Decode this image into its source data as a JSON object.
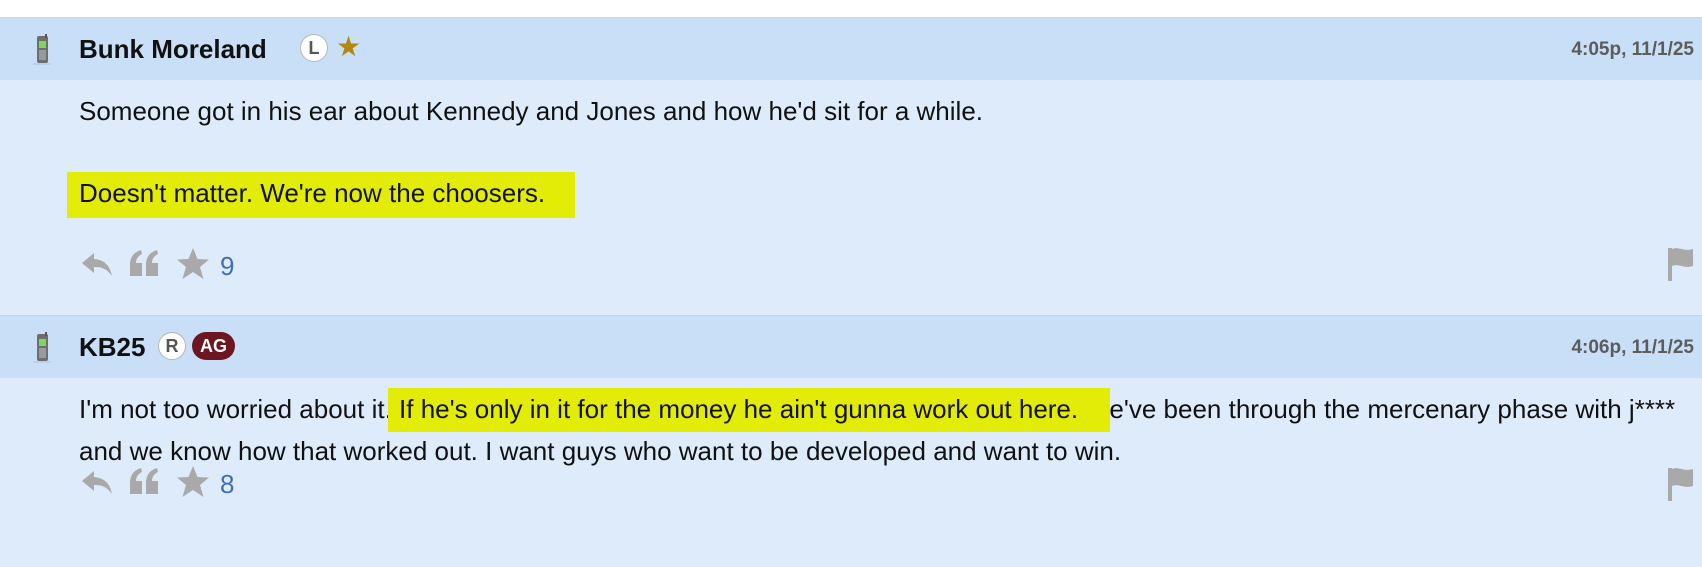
{
  "posts": [
    {
      "author": "Bunk Moreland",
      "badges": {
        "circle": "L",
        "star": "★"
      },
      "timestamp": "4:05p, 11/1/25",
      "line1": "Someone got in his ear about Kennedy and Jones and how he'd sit for a while.",
      "line2_highlighted": "Doesn't matter. We're now the choosers.",
      "star_count": "9"
    },
    {
      "author": "KB25",
      "badges": {
        "circle": "R",
        "tag": "AG",
        "tag_color": "#6b1621"
      },
      "timestamp": "4:06p, 11/1/25",
      "text_before": "I'm not too worried about it.",
      "text_highlighted": " If he's only in it for the money he ain't gunna work out here.",
      "text_after": " We've been through the mercenary phase with j**** and we know how that worked out. I want guys who want to be developed and want to win.",
      "star_count": "8"
    }
  ],
  "icons": {
    "device": "mobile-phone-icon",
    "reply": "reply-icon",
    "quote": "quote-icon",
    "star": "star-icon",
    "flag": "flag-icon"
  },
  "colors": {
    "header_bg": "#c9def7",
    "post_bg": "#deebfb",
    "highlight": "#e2ec06",
    "count_link": "#3f70b5",
    "ag_badge": "#6b1621",
    "gold_star": "#b3880f"
  }
}
